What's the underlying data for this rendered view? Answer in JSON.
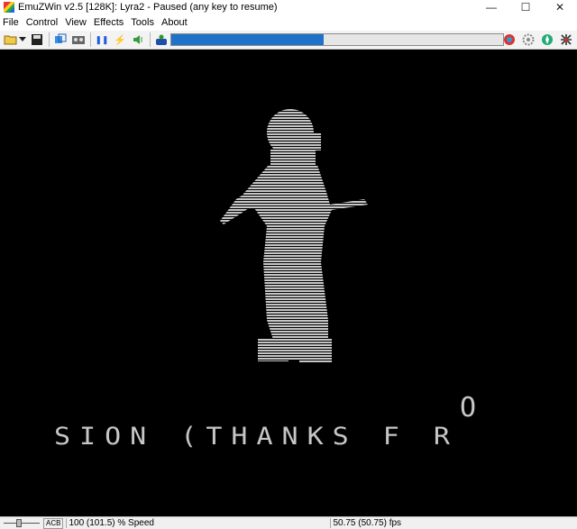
{
  "window": {
    "title": "EmuZWin v2.5 [128K]: Lyra2 - Paused (any key to resume)",
    "minimize_glyph": "—",
    "maximize_glyph": "☐",
    "close_glyph": "✕"
  },
  "menu": [
    "File",
    "Control",
    "View",
    "Effects",
    "Tools",
    "About"
  ],
  "toolbar": {
    "open_icon": "folder-open-icon",
    "save_icon": "disk-icon",
    "pause_glyph": "❚❚",
    "bolt_glyph": "⚡",
    "progress": 0.46,
    "colors": {
      "progress": "#1e73c8"
    }
  },
  "screen": {
    "text_line": "SION (THANKS F R",
    "text_o": "O",
    "colors": {
      "background": "#000000",
      "foreground": "#c6c6c6"
    }
  },
  "status": {
    "acb": "ACB",
    "speed": "100 (101.5) % Speed",
    "fps": "50.75 (50.75) fps"
  }
}
